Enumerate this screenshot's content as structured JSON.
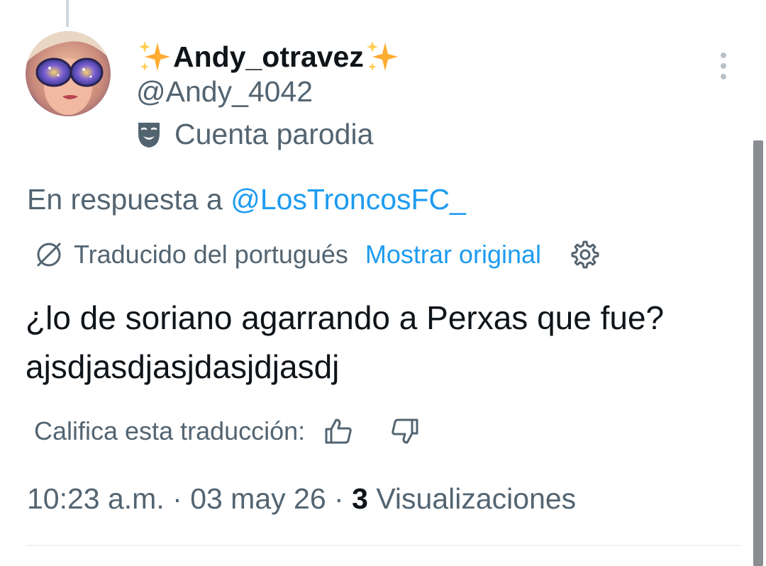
{
  "tweet": {
    "author": {
      "display_name": "Andy_otravez",
      "handle": "@Andy_4042",
      "parody_label": "Cuenta parodia",
      "avatar_icon": "avatar-image"
    },
    "reply_prefix": "En respuesta a",
    "reply_to": "@LosTroncosFC_",
    "translation": {
      "status": "Traducido del portugués",
      "show_original": "Mostrar original"
    },
    "text": "¿lo de soriano agarrando a Perxas que fue? ajsdjasdjasjdasjdjasdj",
    "rate_label": "Califica esta traducción:",
    "time": "10:23 a.m.",
    "date": "03 may 26",
    "views_count": "3",
    "views_label": "Visualizaciones"
  },
  "colors": {
    "link": "#1d9bf0",
    "muted": "#536471",
    "text": "#0f1419",
    "sparkle": "#ffac33"
  }
}
